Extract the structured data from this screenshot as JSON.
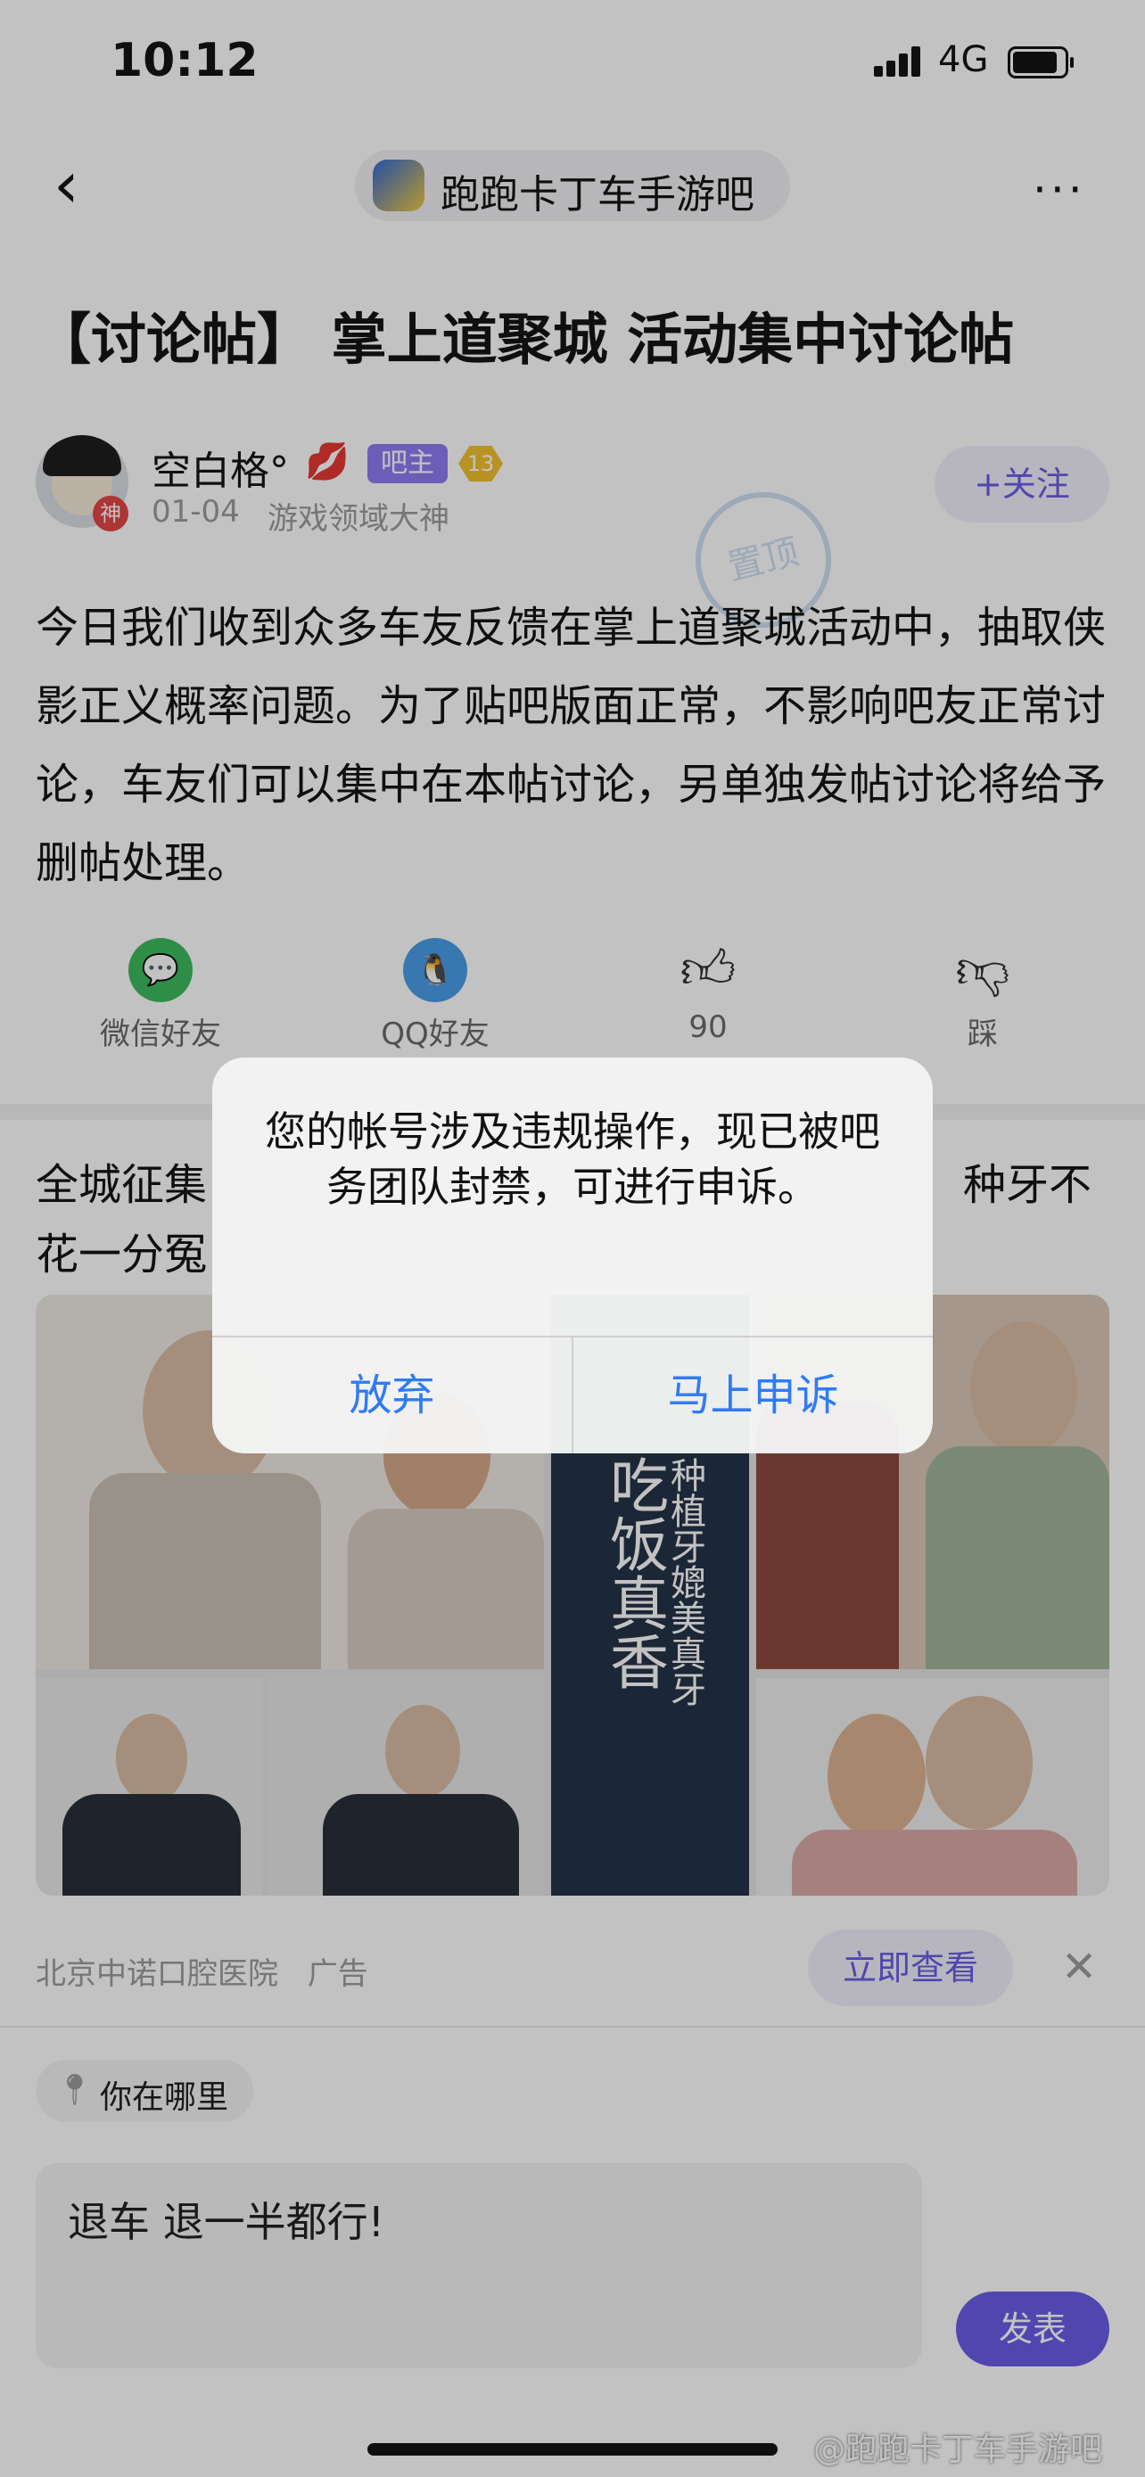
{
  "status_bar": {
    "time": "10:12",
    "network": "4G"
  },
  "nav": {
    "forum_name": "跑跑卡丁车手游吧"
  },
  "post": {
    "title": "【讨论帖】 掌上道聚城 活动集中讨论帖",
    "author": {
      "name": "空白格°",
      "badge": "吧主",
      "level": "13",
      "date": "01-04",
      "rank": "游戏领域大神",
      "avatar_badge": "神"
    },
    "follow_label": "+关注",
    "stamp": "置顶",
    "body": "今日我们收到众多车友反馈在掌上道聚城活动中，抽取侠影正义概率问题。为了贴吧版面正常，不影响吧友正常讨论，车友们可以集中在本帖讨论，另单独发帖讨论将给予删帖处理。"
  },
  "share": [
    {
      "label": "微信好友",
      "icon": "wechat-icon",
      "color": "#3dbb5e"
    },
    {
      "label": "QQ好友",
      "icon": "qq-icon",
      "color": "#4a9de8"
    },
    {
      "label": "90",
      "icon": "thumbs-up-icon"
    },
    {
      "label": "踩",
      "icon": "thumbs-down-icon"
    }
  ],
  "ad": {
    "text_left_1": "全城征集",
    "text_right_1": "种牙不",
    "text_left_2": "花一分冤",
    "slogan_big": "吃饭真香",
    "slogan_small": "种植牙媲美真牙",
    "source": "北京中诺口腔医院",
    "tag": "广告",
    "view_label": "立即查看"
  },
  "location": {
    "label": "你在哪里"
  },
  "reply": {
    "text": "退车 退一半都行!",
    "send_label": "发表"
  },
  "dialog": {
    "message": "您的帐号涉及违规操作，现已被吧务团队封禁，可进行申诉。",
    "cancel_label": "放弃",
    "confirm_label": "马上申诉",
    "button_color": "#2f7bf5"
  },
  "watermark": "@跑跑卡丁车手游吧"
}
